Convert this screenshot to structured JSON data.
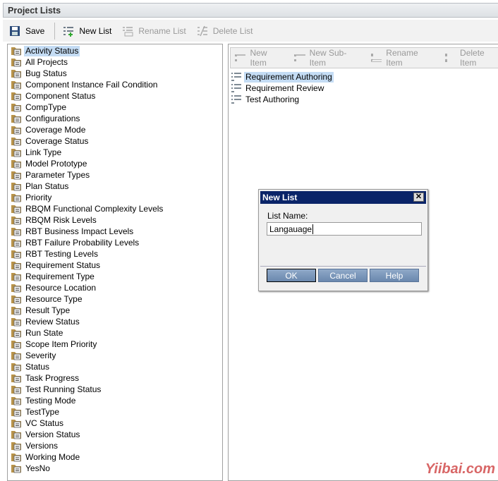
{
  "title": "Project Lists",
  "toolbar": {
    "save": "Save",
    "new_list": "New List",
    "rename_list": "Rename List",
    "delete_list": "Delete List"
  },
  "lists": [
    "Activity Status",
    "All Projects",
    "Bug Status",
    "Component Instance Fail Condition",
    "Component Status",
    "CompType",
    "Configurations",
    "Coverage Mode",
    "Coverage Status",
    "Link Type",
    "Model Prototype",
    "Parameter Types",
    "Plan Status",
    "Priority",
    "RBQM Functional Complexity Levels",
    "RBQM Risk Levels",
    "RBT Business Impact Levels",
    "RBT Failure Probability Levels",
    "RBT Testing Levels",
    "Requirement Status",
    "Requirement Type",
    "Resource Location",
    "Resource Type",
    "Result Type",
    "Review Status",
    "Run State",
    "Scope Item Priority",
    "Severity",
    "Status",
    "Task Progress",
    "Test Running Status",
    "Testing Mode",
    "TestType",
    "VC Status",
    "Version Status",
    "Versions",
    "Working Mode",
    "YesNo"
  ],
  "selected_list": "Activity Status",
  "item_toolbar": {
    "new_item": "New Item",
    "new_sub_item": "New Sub-Item",
    "rename_item": "Rename Item",
    "delete_item": "Delete Item"
  },
  "items": [
    "Requirement Authoring",
    "Requirement Review",
    "Test Authoring"
  ],
  "dialog": {
    "title": "New List",
    "label": "List Name:",
    "value": "Langauage",
    "ok": "OK",
    "cancel": "Cancel",
    "help": "Help"
  },
  "watermark": "Yiibai.com"
}
